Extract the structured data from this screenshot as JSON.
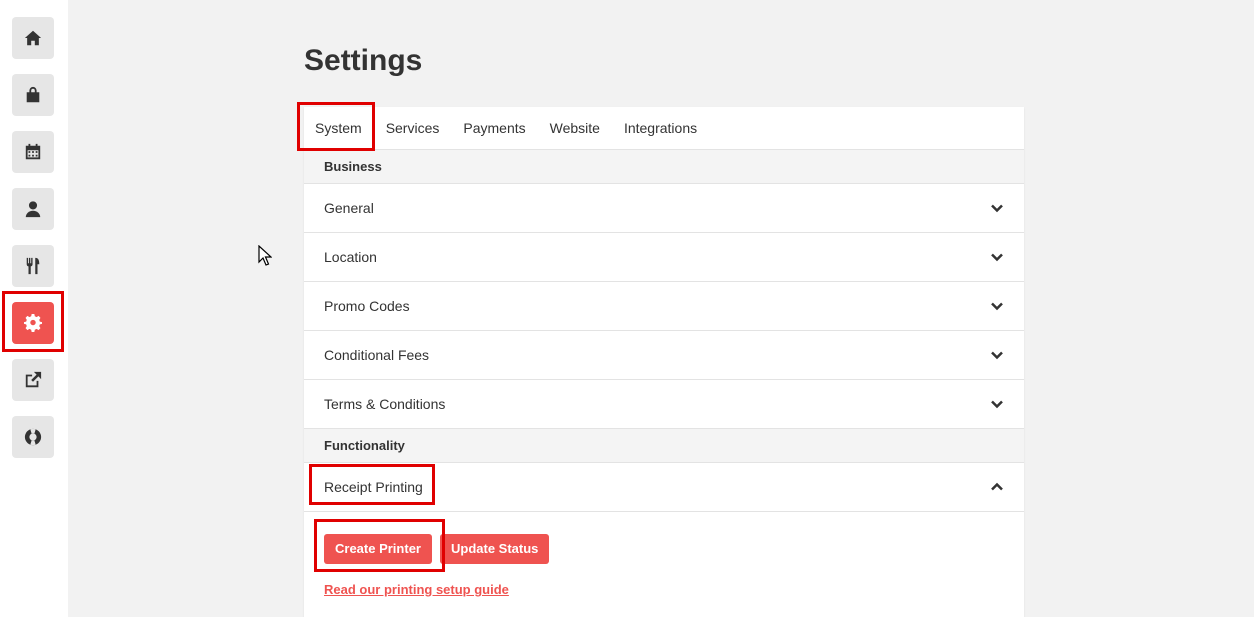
{
  "sidebar": {
    "items": [
      {
        "icon": "home-icon",
        "active": false
      },
      {
        "icon": "shopping-bag-icon",
        "active": false
      },
      {
        "icon": "calendar-icon",
        "active": false
      },
      {
        "icon": "user-icon",
        "active": false
      },
      {
        "icon": "utensils-icon",
        "active": false
      },
      {
        "icon": "gear-icon",
        "active": true
      },
      {
        "icon": "external-link-icon",
        "active": false
      },
      {
        "icon": "life-ring-icon",
        "active": false
      }
    ]
  },
  "page": {
    "title": "Settings"
  },
  "tabs": [
    "System",
    "Services",
    "Payments",
    "Website",
    "Integrations"
  ],
  "sections": {
    "business": {
      "label": "Business",
      "rows": [
        "General",
        "Location",
        "Promo Codes",
        "Conditional Fees",
        "Terms & Conditions"
      ]
    },
    "functionality": {
      "label": "Functionality",
      "rows": [
        "Receipt Printing"
      ]
    }
  },
  "receipt_printing": {
    "create_button": "Create Printer",
    "update_button": "Update Status",
    "guide_link": "Read our printing setup guide"
  },
  "colors": {
    "accent": "#ef5350",
    "highlight": "#e00000"
  }
}
